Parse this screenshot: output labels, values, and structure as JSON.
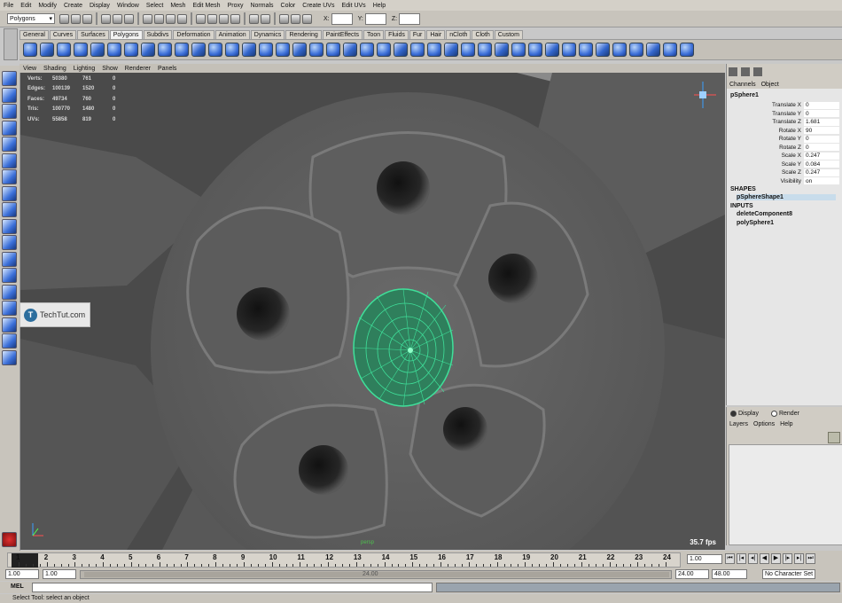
{
  "menus": [
    "File",
    "Edit",
    "Modify",
    "Create",
    "Display",
    "Window",
    "Select",
    "Mesh",
    "Edit Mesh",
    "Proxy",
    "Normals",
    "Color",
    "Create UVs",
    "Edit UVs",
    "Help"
  ],
  "status_line": {
    "mode": "Polygons",
    "x_label": "X:",
    "y_label": "Y:",
    "z_label": "Z:"
  },
  "shelf_tabs": [
    "General",
    "Curves",
    "Surfaces",
    "Polygons",
    "Subdivs",
    "Deformation",
    "Animation",
    "Dynamics",
    "Rendering",
    "PaintEffects",
    "Toon",
    "Fluids",
    "Fur",
    "Hair",
    "nCloth",
    "Cloth",
    "Custom"
  ],
  "shelf_active_tab": "Polygons",
  "viewport_menu": [
    "View",
    "Shading",
    "Lighting",
    "Show",
    "Renderer",
    "Panels"
  ],
  "hud": [
    {
      "label": "Verts:",
      "v1": "50380",
      "v2": "761",
      "v3": "0"
    },
    {
      "label": "Edges:",
      "v1": "100139",
      "v2": "1520",
      "v3": "0"
    },
    {
      "label": "Faces:",
      "v1": "49734",
      "v3": "0",
      "v2": "760"
    },
    {
      "label": "Tris:",
      "v1": "100770",
      "v2": "1480",
      "v3": "0"
    },
    {
      "label": "UVs:",
      "v1": "55858",
      "v2": "819",
      "v3": "0"
    }
  ],
  "fps": "35.7 fps",
  "camera": "persp",
  "watermark": {
    "logo": "T",
    "text": "TechTut.com"
  },
  "channel_box": {
    "menu": [
      "Channels",
      "Object"
    ],
    "object": "pSphere1",
    "attributes": [
      {
        "name": "Translate X",
        "value": "0"
      },
      {
        "name": "Translate Y",
        "value": "0"
      },
      {
        "name": "Translate Z",
        "value": "1.681"
      },
      {
        "name": "Rotate X",
        "value": "90"
      },
      {
        "name": "Rotate Y",
        "value": "0"
      },
      {
        "name": "Rotate Z",
        "value": "0"
      },
      {
        "name": "Scale X",
        "value": "0.247"
      },
      {
        "name": "Scale Y",
        "value": "0.084"
      },
      {
        "name": "Scale Z",
        "value": "0.247"
      },
      {
        "name": "Visibility",
        "value": "on"
      }
    ],
    "shapes_header": "SHAPES",
    "shape": "pSphereShape1",
    "inputs_header": "INPUTS",
    "inputs": [
      "deleteComponent8",
      "polySphere1"
    ]
  },
  "layer_editor": {
    "display": "Display",
    "render": "Render",
    "menu": [
      "Layers",
      "Options",
      "Help"
    ]
  },
  "time_slider": {
    "ticks": [
      "1",
      "2",
      "3",
      "4",
      "5",
      "6",
      "7",
      "8",
      "9",
      "10",
      "11",
      "12",
      "13",
      "14",
      "15",
      "16",
      "17",
      "18",
      "19",
      "20",
      "21",
      "22",
      "23",
      "24"
    ],
    "current": "1.00"
  },
  "range_slider": {
    "start": "1.00",
    "playback_start": "1.00",
    "label": "24.00",
    "playback_end": "24.00",
    "end": "48.00",
    "character_set": "No Character Set"
  },
  "command_line": {
    "label": "MEL"
  },
  "help_line": "Select Tool: select an object"
}
